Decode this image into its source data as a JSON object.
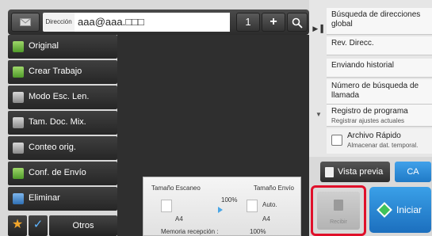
{
  "address_bar": {
    "label": "Dirección",
    "value": "aaa@aaa.□□□",
    "count": "1",
    "plus": "+"
  },
  "sidebar": {
    "items": [
      {
        "label": "Original",
        "icon": "original-icon"
      },
      {
        "label": "Crear Trabajo",
        "icon": "job-build-icon"
      },
      {
        "label": "Modo Esc. Len.",
        "icon": "slow-scan-icon"
      },
      {
        "label": "Tam. Doc. Mix.",
        "icon": "mixed-size-icon"
      },
      {
        "label": "Conteo orig.",
        "icon": "original-count-icon"
      },
      {
        "label": "Conf. de Envío",
        "icon": "send-settings-icon"
      },
      {
        "label": "Eliminar",
        "icon": "erase-icon"
      }
    ],
    "otros": "Otros"
  },
  "scan_info": {
    "scan_size_label": "Tamaño Escaneo",
    "send_size_label": "Tamaño Envío",
    "ratio": "100%",
    "send_mode": "Auto.",
    "scan_paper": "A4",
    "send_paper": "A4",
    "memory_label": "Memoria recepción :",
    "memory_value": "100%"
  },
  "right_panel": {
    "items": [
      {
        "label": "Búsqueda de direcciones global"
      },
      {
        "label": "Rev. Direcc."
      },
      {
        "label": "Enviando historial"
      },
      {
        "label": "Número de búsqueda de llamada"
      },
      {
        "label": "Registro de programa",
        "sub": "Registrar ajustes actuales"
      }
    ],
    "rapid_file": {
      "label": "Archivo Rápido",
      "sub": "Almacenar dat. temporal."
    }
  },
  "actions": {
    "preview": "Vista previa",
    "ca": "CA",
    "receive": "Recibir",
    "start": "Iniciar"
  },
  "colors": {
    "accent_blue": "#1f7ac6",
    "highlight_red": "#e0102a",
    "start_green": "#3fc35a"
  }
}
